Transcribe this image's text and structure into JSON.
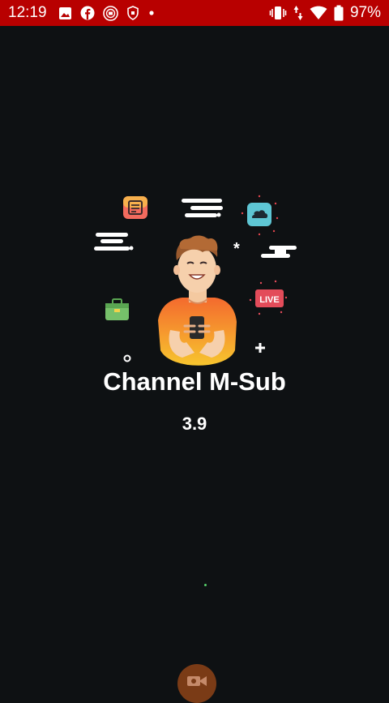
{
  "status_bar": {
    "time": "12:19",
    "battery": "97%",
    "left_icons": [
      "image-icon",
      "facebook-icon",
      "app-icon",
      "shield-icon",
      "dot-icon"
    ],
    "right_icons": [
      "vibrate-icon",
      "data-arrows-icon",
      "wifi-icon",
      "battery-icon"
    ]
  },
  "splash": {
    "title": "Channel M-Sub",
    "version": "3.9",
    "badge_live": "LIVE"
  },
  "colors": {
    "status_bar_bg": "#b80000",
    "background": "#0e1113",
    "fab": "#7a3b16",
    "accent_dot": "#56d06a"
  },
  "fab": {
    "icon": "video-camera-icon"
  }
}
